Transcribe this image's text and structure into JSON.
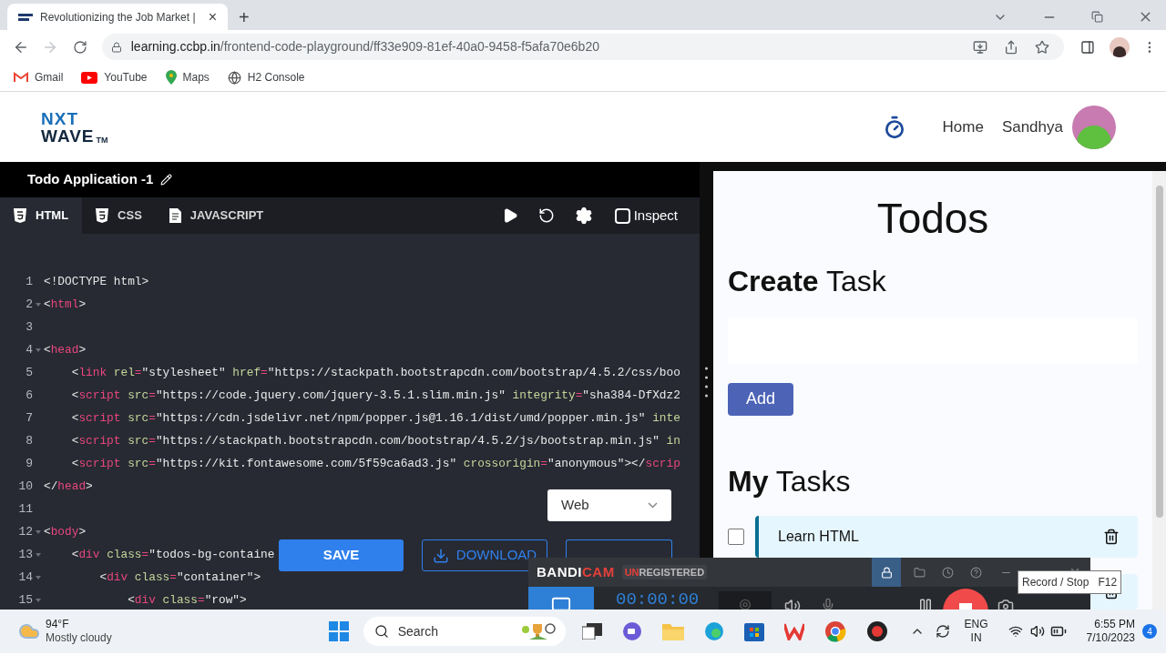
{
  "browser": {
    "tab": {
      "title": "Revolutionizing the Job Market |",
      "close": "×"
    },
    "new_tab": "+",
    "address": {
      "host": "learning.ccbp.in",
      "path": "/frontend-code-playground/ff33e909-81ef-40a0-9458-f5afa70e6b20"
    },
    "bookmarks": [
      {
        "label": "Gmail",
        "kind": "gmail"
      },
      {
        "label": "YouTube",
        "kind": "youtube"
      },
      {
        "label": "Maps",
        "kind": "maps"
      },
      {
        "label": "H2 Console",
        "kind": "globe"
      }
    ]
  },
  "site": {
    "logo": {
      "top": "NXT",
      "bottom": "WAVE",
      "mark": "TM"
    },
    "nav": [
      "Home"
    ],
    "user": "Sandhya"
  },
  "editor": {
    "title": "Todo Application -1",
    "tabs": [
      {
        "label": "HTML",
        "selected": true,
        "kind": "html"
      },
      {
        "label": "CSS",
        "selected": false,
        "kind": "css"
      },
      {
        "label": "JAVASCRIPT",
        "selected": false,
        "kind": "js"
      }
    ],
    "inspect": {
      "label": "Inspect",
      "checked": false
    },
    "lines": [
      {
        "number": "1",
        "fold": false,
        "tokens": [
          {
            "kind": "plain",
            "text": "<!DOCTYPE html>"
          }
        ]
      },
      {
        "number": "2",
        "fold": true,
        "tokens": [
          {
            "kind": "plain",
            "text": "<"
          },
          {
            "kind": "tag",
            "text": "html"
          },
          {
            "kind": "plain",
            "text": ">"
          }
        ]
      },
      {
        "number": "3",
        "fold": false
      },
      {
        "number": "4",
        "fold": true,
        "tokens": [
          {
            "kind": "plain",
            "text": "<"
          },
          {
            "kind": "tag",
            "text": "head"
          },
          {
            "kind": "plain",
            "text": ">"
          }
        ]
      },
      {
        "number": "5",
        "fold": false,
        "tokens": [
          {
            "kind": "plain",
            "text": "    <"
          },
          {
            "kind": "tag",
            "text": "link"
          },
          {
            "kind": "attr",
            "text": " rel"
          },
          {
            "kind": "tag",
            "text": "="
          },
          {
            "kind": "string",
            "text": "\"stylesheet\""
          },
          {
            "kind": "attr",
            "text": " href"
          },
          {
            "kind": "tag",
            "text": "="
          },
          {
            "kind": "string",
            "text": "\"https://stackpath.bootstrapcdn.com/bootstrap/4.5.2/css/boo"
          }
        ]
      },
      {
        "number": "6",
        "fold": false,
        "tokens": [
          {
            "kind": "plain",
            "text": "    <"
          },
          {
            "kind": "tag",
            "text": "script"
          },
          {
            "kind": "attr",
            "text": " src"
          },
          {
            "kind": "tag",
            "text": "="
          },
          {
            "kind": "string",
            "text": "\"https://code.jquery.com/jquery-3.5.1.slim.min.js\""
          },
          {
            "kind": "attr",
            "text": " integrity"
          },
          {
            "kind": "tag",
            "text": "="
          },
          {
            "kind": "string",
            "text": "\"sha384-DfXdz2"
          }
        ]
      },
      {
        "number": "7",
        "fold": false,
        "tokens": [
          {
            "kind": "plain",
            "text": "    <"
          },
          {
            "kind": "tag",
            "text": "script"
          },
          {
            "kind": "attr",
            "text": " src"
          },
          {
            "kind": "tag",
            "text": "="
          },
          {
            "kind": "string",
            "text": "\"https://cdn.jsdelivr.net/npm/popper.js@1.16.1/dist/umd/popper.min.js\""
          },
          {
            "kind": "attr",
            "text": " inte"
          }
        ]
      },
      {
        "number": "8",
        "fold": false,
        "tokens": [
          {
            "kind": "plain",
            "text": "    <"
          },
          {
            "kind": "tag",
            "text": "script"
          },
          {
            "kind": "attr",
            "text": " src"
          },
          {
            "kind": "tag",
            "text": "="
          },
          {
            "kind": "string",
            "text": "\"https://stackpath.bootstrapcdn.com/bootstrap/4.5.2/js/bootstrap.min.js\""
          },
          {
            "kind": "attr",
            "text": " in"
          }
        ]
      },
      {
        "number": "9",
        "fold": false,
        "tokens": [
          {
            "kind": "plain",
            "text": "    <"
          },
          {
            "kind": "tag",
            "text": "script"
          },
          {
            "kind": "attr",
            "text": " src"
          },
          {
            "kind": "tag",
            "text": "="
          },
          {
            "kind": "string",
            "text": "\"https://kit.fontawesome.com/5f59ca6ad3.js\""
          },
          {
            "kind": "attr",
            "text": " crossorigin"
          },
          {
            "kind": "tag",
            "text": "="
          },
          {
            "kind": "string",
            "text": "\"anonymous\""
          },
          {
            "kind": "plain",
            "text": "></"
          },
          {
            "kind": "tag",
            "text": "scrip"
          }
        ]
      },
      {
        "number": "10",
        "fold": false,
        "tokens": [
          {
            "kind": "plain",
            "text": "</"
          },
          {
            "kind": "tag",
            "text": "head"
          },
          {
            "kind": "plain",
            "text": ">"
          }
        ]
      },
      {
        "number": "11",
        "fold": false
      },
      {
        "number": "12",
        "fold": true,
        "tokens": [
          {
            "kind": "plain",
            "text": "<"
          },
          {
            "kind": "tag",
            "text": "body"
          },
          {
            "kind": "plain",
            "text": ">"
          }
        ]
      },
      {
        "number": "13",
        "fold": true,
        "tokens": [
          {
            "kind": "plain",
            "text": "    <"
          },
          {
            "kind": "tag",
            "text": "div"
          },
          {
            "kind": "attr",
            "text": " class"
          },
          {
            "kind": "tag",
            "text": "="
          },
          {
            "kind": "string",
            "text": "\"todos-bg-containe"
          }
        ]
      },
      {
        "number": "14",
        "fold": true,
        "tokens": [
          {
            "kind": "plain",
            "text": "        <"
          },
          {
            "kind": "tag",
            "text": "div"
          },
          {
            "kind": "attr",
            "text": " class"
          },
          {
            "kind": "tag",
            "text": "="
          },
          {
            "kind": "string",
            "text": "\"container\""
          },
          {
            "kind": "plain",
            "text": ">"
          }
        ]
      },
      {
        "number": "15",
        "fold": true,
        "tokens": [
          {
            "kind": "plain",
            "text": "            <"
          },
          {
            "kind": "tag",
            "text": "div"
          },
          {
            "kind": "attr",
            "text": " class"
          },
          {
            "kind": "tag",
            "text": "="
          },
          {
            "kind": "string",
            "text": "\"row\""
          },
          {
            "kind": "plain",
            "text": ">"
          }
        ]
      }
    ],
    "target": "Web",
    "actions": [
      {
        "label": "SAVE",
        "kind": "primary"
      },
      {
        "label": "DOWNLOAD",
        "kind": "download"
      },
      {
        "kind": "create"
      }
    ]
  },
  "preview": {
    "title": "Todos",
    "create_heading": "**Create** Task",
    "add": "Add",
    "tasks_heading": "**My** Tasks",
    "tasks": [
      {
        "label": "Learn HTML",
        "checked": false
      }
    ]
  },
  "recorder": {
    "logo": [
      {
        "text": "BANDI",
        "color": "#ffffff"
      },
      {
        "text": "CAM",
        "color": "#e5403a"
      }
    ],
    "badge": [
      {
        "text": "UN",
        "color": "#e5403a"
      },
      {
        "text": "REGISTERED",
        "color": "#bbbbbb"
      }
    ],
    "timer": "00:00:00",
    "tooltip": {
      "label": "Record / Stop",
      "key": "F12"
    }
  },
  "taskbar": {
    "weather": {
      "temp": "94°F",
      "text": "Mostly cloudy"
    },
    "search": "Search",
    "language": [
      "ENG",
      "IN"
    ],
    "time": "6:55 PM",
    "date": "7/10/2023",
    "notifications": "4"
  }
}
